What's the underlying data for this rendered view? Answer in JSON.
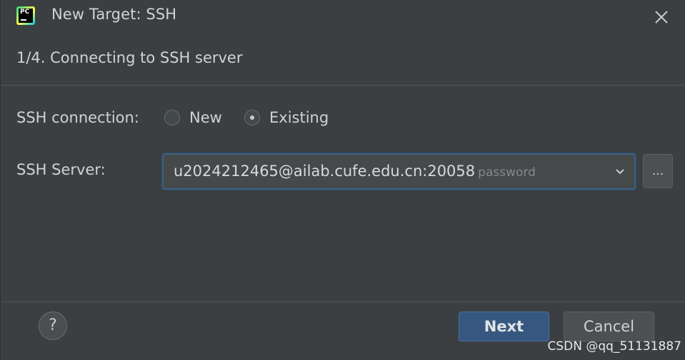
{
  "window": {
    "title": "New Target: SSH",
    "app_icon_text": "PC"
  },
  "step": {
    "title": "1/4. Connecting to SSH server"
  },
  "form": {
    "connection_label": "SSH connection:",
    "radio_new_label": "New",
    "radio_existing_label": "Existing",
    "selected_option": "Existing",
    "server_label": "SSH Server:",
    "server_value": "u2024212465@ailab.cufe.edu.cn:20058",
    "server_auth_hint": "password",
    "browse_label": "..."
  },
  "footer": {
    "help_label": "?",
    "next_label": "Next",
    "cancel_label": "Cancel"
  },
  "watermark": "CSDN @qq_51131887",
  "colors": {
    "background": "#3c3f41",
    "accent": "#365880",
    "focus_border": "#3d6185"
  }
}
